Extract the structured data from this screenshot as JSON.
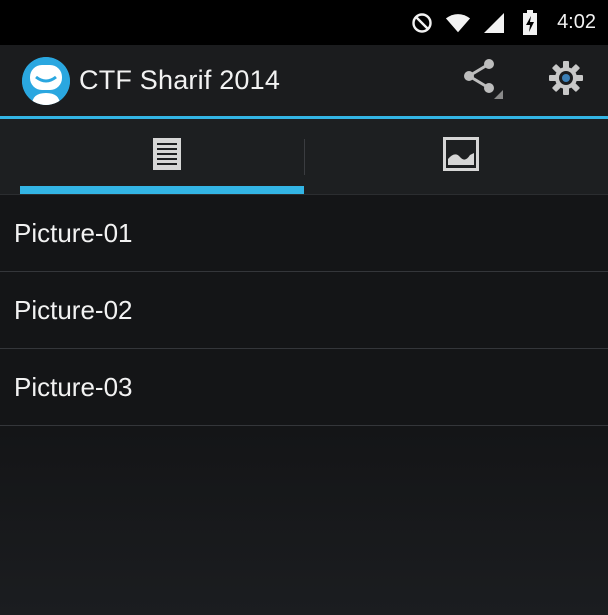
{
  "status_bar": {
    "time": "4:02",
    "icons": [
      "do-not-disturb-icon",
      "wifi-icon",
      "cell-signal-icon",
      "battery-charging-icon"
    ]
  },
  "action_bar": {
    "title": "CTF Sharif 2014",
    "icon": "app-logo-icon",
    "actions": [
      "share-icon",
      "settings-gear-icon"
    ]
  },
  "tabs": [
    {
      "icon": "document-list-icon",
      "selected": true
    },
    {
      "icon": "image-icon",
      "selected": false
    }
  ],
  "list": {
    "items": [
      {
        "label": "Picture-01"
      },
      {
        "label": "Picture-02"
      },
      {
        "label": "Picture-03"
      }
    ]
  },
  "colors": {
    "accent": "#33b5e5",
    "status_bar_bg": "#000000",
    "action_bar_bg": "#1b1c1e",
    "content_bg": "#141517"
  }
}
